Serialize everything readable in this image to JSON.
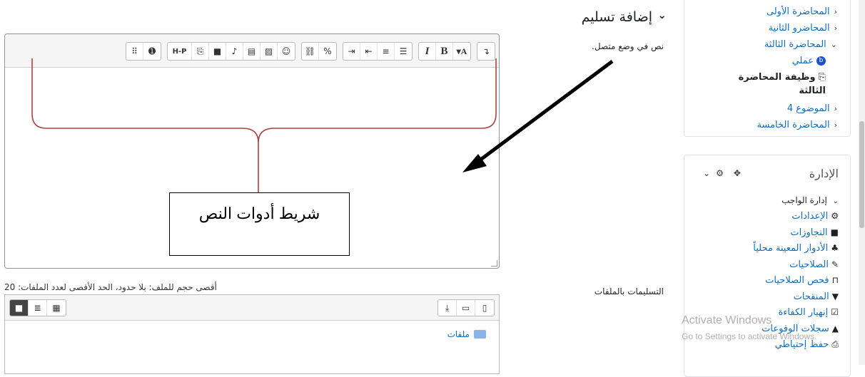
{
  "section": {
    "title": "إضافة تسليم",
    "collapse_icon": "chevron-down-icon"
  },
  "online_text": {
    "label": "نص في وضع متصل."
  },
  "editor": {
    "toolbar_groups": [
      {
        "name": "toolbar-group-1",
        "buttons": [
          {
            "name": "show-more-buttons",
            "glyph": "⠿"
          },
          {
            "name": "accessibility-checker",
            "glyph": "➊"
          }
        ]
      },
      {
        "name": "toolbar-group-2",
        "buttons": [
          {
            "name": "h5p",
            "glyph": "H-P"
          },
          {
            "name": "manage-files",
            "glyph": "⎘"
          },
          {
            "name": "record-video",
            "glyph": "■"
          },
          {
            "name": "record-audio",
            "glyph": "♪"
          },
          {
            "name": "insert-media",
            "glyph": "▤"
          },
          {
            "name": "insert-image",
            "glyph": "▨"
          },
          {
            "name": "insert-emoji",
            "glyph": "☺"
          }
        ]
      },
      {
        "name": "toolbar-group-3",
        "buttons": [
          {
            "name": "unlink",
            "glyph": "⛓"
          },
          {
            "name": "link",
            "glyph": "%"
          }
        ]
      },
      {
        "name": "toolbar-group-4",
        "buttons": [
          {
            "name": "indent",
            "glyph": "⇥"
          },
          {
            "name": "outdent",
            "glyph": "⇤"
          },
          {
            "name": "ordered-list",
            "glyph": "≡"
          },
          {
            "name": "unordered-list",
            "glyph": "☰"
          }
        ]
      },
      {
        "name": "toolbar-group-5",
        "buttons": [
          {
            "name": "italic",
            "glyph": "I"
          },
          {
            "name": "bold",
            "glyph": "B"
          },
          {
            "name": "paragraph-styles",
            "glyph": "▾A"
          }
        ]
      },
      {
        "name": "toolbar-group-6",
        "buttons": [
          {
            "name": "toggle-toolbar",
            "glyph": "↴"
          }
        ]
      }
    ]
  },
  "annotation": {
    "text": "شريط أدوات النص",
    "bracket_color": "#a94442",
    "arrow_color": "#000000"
  },
  "file_limits": {
    "text": "أقصى حجم للملف: بلا حدود، الحد الأقصى لعدد الملفات: 20"
  },
  "file_submissions": {
    "label": "التسليمات بالملفات"
  },
  "filepicker": {
    "view_buttons": [
      {
        "name": "view-folders",
        "glyph": "■"
      },
      {
        "name": "view-list",
        "glyph": "≣"
      },
      {
        "name": "view-icons",
        "glyph": "▦"
      }
    ],
    "action_buttons": [
      {
        "name": "download",
        "glyph": "⤓"
      },
      {
        "name": "create-folder",
        "glyph": "▭"
      },
      {
        "name": "add-file",
        "glyph": "▯"
      }
    ],
    "folder_label": "ملفات"
  },
  "nav": {
    "items": [
      {
        "label": "المحاضرة الأولى",
        "caret": "‹"
      },
      {
        "label": "المحاضرو الثانية",
        "caret": "‹"
      },
      {
        "label": "المحاضرة الثالثة",
        "caret": "⌄"
      },
      {
        "label": "عملي",
        "icon": "forum-icon"
      },
      {
        "label": "وظيفة المحاضرة",
        "label2": "الثالثة",
        "icon": "assignment-icon"
      },
      {
        "label": "الموضوع 4",
        "caret": "‹"
      },
      {
        "label": "المحاضرة الخامسة",
        "caret": "‹"
      }
    ]
  },
  "admin": {
    "title": "الإدارة",
    "section_label": "إدارة الواجب",
    "items": [
      {
        "label": "الإعدادات",
        "icon": "gear-icon"
      },
      {
        "label": "التجاوزات",
        "icon": "square-icon"
      },
      {
        "label": "الأدوار المعينة محلياً",
        "icon": "users-icon"
      },
      {
        "label": "الصلاحيات",
        "icon": "edit-icon"
      },
      {
        "label": "فحص الصلاحيات",
        "icon": "lock-icon"
      },
      {
        "label": "المنقحات",
        "icon": "filter-icon"
      },
      {
        "label": "إنهيار الكفاءة",
        "icon": "check-square-icon"
      },
      {
        "label": "سجلات الوقوعات",
        "icon": "chart-icon"
      },
      {
        "label": "حفظ إحتياطي",
        "icon": "backup-icon"
      }
    ]
  },
  "watermark": {
    "line1": "Activate Windows",
    "line2": "Go to Settings to activate Windows."
  }
}
